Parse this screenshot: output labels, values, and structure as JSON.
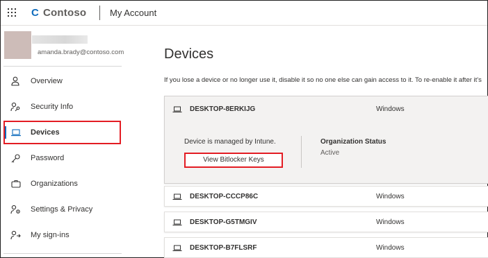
{
  "topbar": {
    "brand": "Contoso",
    "brand_logo": "C",
    "app_title": "My Account",
    "icons": [
      "waffle-menu-icon",
      "contoso-logo-icon"
    ]
  },
  "user": {
    "email": "amanda.brady@contoso.com"
  },
  "sidebar": {
    "items": [
      {
        "label": "Overview",
        "icon": "person-icon"
      },
      {
        "label": "Security Info",
        "icon": "key-person-icon"
      },
      {
        "label": "Devices",
        "icon": "laptop-icon",
        "active": true
      },
      {
        "label": "Password",
        "icon": "key-icon"
      },
      {
        "label": "Organizations",
        "icon": "briefcase-icon"
      },
      {
        "label": "Settings & Privacy",
        "icon": "settings-person-icon"
      },
      {
        "label": "My sign-ins",
        "icon": "sign-ins-icon"
      }
    ]
  },
  "main": {
    "title": "Devices",
    "description": "If you lose a device or no longer use it, disable it so no one else can gain access to it. To re-enable it after it's",
    "devices": [
      {
        "name": "DESKTOP-8ERKIJG",
        "os": "Windows",
        "expanded": true,
        "managed_text": "Device is managed by Intune.",
        "action_label": "View Bitlocker Keys",
        "org_status_label": "Organization Status",
        "org_status_value": "Active"
      },
      {
        "name": "DESKTOP-CCCP86C",
        "os": "Windows"
      },
      {
        "name": "DESKTOP-G5TMGIV",
        "os": "Windows"
      },
      {
        "name": "DESKTOP-B7FLSRF",
        "os": "Windows"
      }
    ]
  },
  "colors": {
    "accent": "#0f6cbd",
    "highlight": "#e31c23",
    "text": "#323130"
  }
}
